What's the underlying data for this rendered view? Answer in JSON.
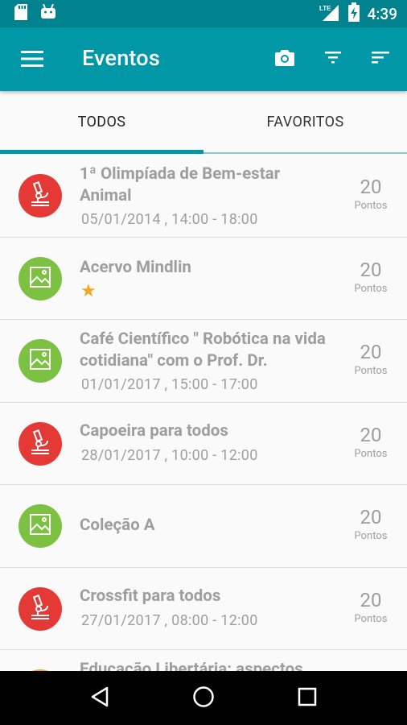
{
  "status": {
    "time": "4:39",
    "network": "LTE"
  },
  "app_bar": {
    "title": "Eventos"
  },
  "tabs": [
    {
      "label": "TODOS",
      "active": true
    },
    {
      "label": "FAVORITOS",
      "active": false
    }
  ],
  "events": [
    {
      "title": "1ª Olimpíada de Bem-estar Animal",
      "date": "05/01/2014 , 14:00 - 18:00",
      "points": "20",
      "points_label": "Pontos",
      "icon": "microscope-icon",
      "color": "red",
      "favorite": false
    },
    {
      "title": "Acervo Mindlin",
      "date": "",
      "points": "20",
      "points_label": "Pontos",
      "icon": "image-icon",
      "color": "green",
      "favorite": true
    },
    {
      "title": "Café Científico \" Robótica na vida cotidiana\" com  o Prof. Dr.",
      "date": "01/01/2017 , 15:00 - 17:00",
      "points": "20",
      "points_label": "Pontos",
      "icon": "image-icon",
      "color": "green",
      "favorite": false
    },
    {
      "title": "Capoeira para todos",
      "date": "28/01/2017 , 10:00 - 12:00",
      "points": "20",
      "points_label": "Pontos",
      "icon": "microscope-icon",
      "color": "red",
      "favorite": false
    },
    {
      "title": "Coleção A",
      "date": "",
      "points": "20",
      "points_label": "Pontos",
      "icon": "image-icon",
      "color": "green",
      "favorite": false
    },
    {
      "title": "Crossfit para todos",
      "date": "27/01/2017 , 08:00 - 12:00",
      "points": "20",
      "points_label": "Pontos",
      "icon": "microscope-icon",
      "color": "red",
      "favorite": false
    },
    {
      "title": "Educação Libertária: aspectos",
      "date": "",
      "points": "",
      "points_label": "",
      "icon": "",
      "color": "orange",
      "favorite": false
    }
  ],
  "colors": {
    "primary": "#0098a6",
    "primary_dark": "#00838f",
    "red": "#e53935",
    "green": "#7cc142",
    "star": "#f5a623"
  }
}
